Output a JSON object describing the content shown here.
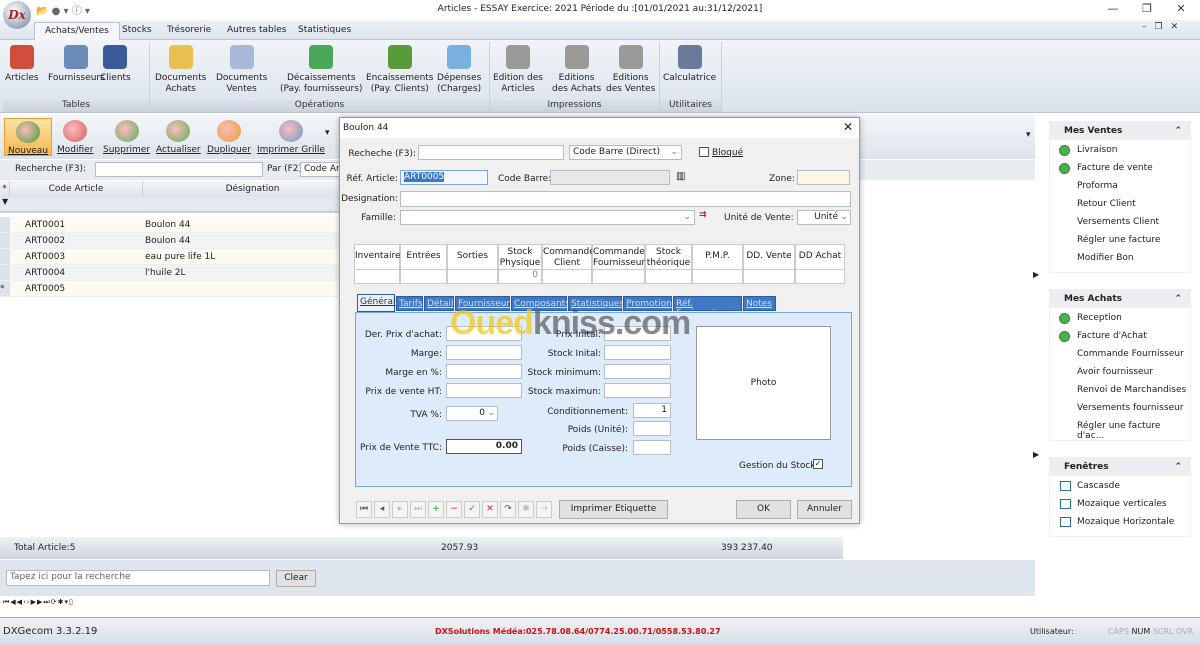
{
  "window": {
    "title": "Articles - ESSAY Exercice: 2021 Période du :[01/01/2021 au:31/12/2021]",
    "logo": "Dx"
  },
  "ribbon_tabs": [
    "Achats/Ventes",
    "Stocks",
    "Trésorerie",
    "Autres tables",
    "Statistiques"
  ],
  "ribbon_groups": [
    {
      "label": "Tables",
      "buttons": [
        "Articles",
        "Fournisseurs",
        "Clients"
      ]
    },
    {
      "label": "Opérations",
      "buttons": [
        "Documents\nAchats",
        "Documents\nVentes",
        "Décaissements\n(Pay. fournisseurs)",
        "Encaissements\n(Pay. Clients)",
        "Dépenses\n(Charges)"
      ]
    },
    {
      "label": "Impressions",
      "buttons": [
        "Edition des\nArticles",
        "Editions\ndes Achats",
        "Editions\ndes Ventes"
      ]
    },
    {
      "label": "Utilitaires",
      "buttons": [
        "Calculatrice"
      ]
    }
  ],
  "toolbar": [
    "Nouveau",
    "Modifier",
    "Supprimer",
    "Actualiser",
    "Dupliquer",
    "Imprimer Grille"
  ],
  "search": {
    "label": "Recherche (F3):",
    "value": "",
    "par_label": "Par (F2)",
    "par_value": "Code Article"
  },
  "grid": {
    "columns": [
      "Code Article",
      "Désignation"
    ],
    "rows": [
      [
        "ART0001",
        "Boulon 44"
      ],
      [
        "ART0002",
        "Boulon 44"
      ],
      [
        "ART0003",
        "eau  pure life 1L"
      ],
      [
        "ART0004",
        "l'huile 2L"
      ],
      [
        "ART0005",
        ""
      ]
    ]
  },
  "footer": {
    "total": "Total Article:5",
    "sum1": "2057.93",
    "sum2": "393 237.40",
    "search_placeholder": "Tapez ici pour la recherche",
    "clear": "Clear"
  },
  "dialog": {
    "title": "Boulon 44",
    "recherche_label": "Recheche (F3):",
    "recherche_value": "",
    "mode": "Code Barre (Direct)",
    "bloque": "Bloqué",
    "bloque_checked": false,
    "ref_label": "Réf. Article:",
    "ref_value": "ART0005",
    "codebarre_label": "Code Barre:",
    "zone_label": "Zone:",
    "designation_label": "Designation:",
    "famille_label": "Famille:",
    "unite_label": "Unité de Vente:",
    "unite_value": "Unité",
    "stock_headers": [
      "Inventaire",
      "Entrées",
      "Sorties",
      "Stock\nPhysique",
      "Commandes\nClient",
      "Commande\nFournisseur",
      "Stock\nthéorique",
      "P.M.P.",
      "DD. Vente",
      "DD Achat"
    ],
    "stock_values": [
      "",
      "",
      "",
      "0",
      "",
      "",
      "",
      "",
      "",
      ""
    ],
    "tabs": [
      "Général",
      "Tarifs",
      "Détail",
      "Fournisseurs",
      "Composants",
      "Statistiques",
      "Promotion",
      "Réf. Fusionnées",
      "Notes"
    ],
    "left_fields": [
      "Der. Prix d'achat:",
      "Marge:",
      "Marge en %:",
      "Prix de vente HT:"
    ],
    "tva_label": "TVA %:",
    "tva_value": "0",
    "ttc_label": "Prix de Vente TTC:",
    "ttc_value": "0.00",
    "mid_fields": [
      "Prix Inital:",
      "Stock Inital:",
      "Stock minimum:",
      "Stock maximun:"
    ],
    "cond_label": "Conditionnement:",
    "cond_value": "1",
    "poids_unite": "Poids (Unité):",
    "poids_caisse": "Poids (Caisse):",
    "photo": "Photo",
    "gestion_stock": "Gestion du Stock",
    "gestion_checked": true,
    "print_label": "Imprimer Etiquette",
    "ok": "OK",
    "cancel": "Annuler"
  },
  "watermark": "Ouedkniss.com",
  "right_panel": [
    {
      "title": "Mes Ventes",
      "items": [
        {
          "label": "Livraison",
          "icon": "green-arrow-right"
        },
        {
          "label": "Facture de vente",
          "icon": "green-arrow-right"
        },
        {
          "label": "Proforma"
        },
        {
          "label": "Retour Client"
        },
        {
          "label": "Versements Client"
        },
        {
          "label": "Régler une facture"
        },
        {
          "label": "Modifier Bon"
        }
      ]
    },
    {
      "title": "Mes Achats",
      "items": [
        {
          "label": "Reception",
          "icon": "green-arrow-left"
        },
        {
          "label": "Facture d'Achat",
          "icon": "green-arrow-left"
        },
        {
          "label": "Commande Fournisseur"
        },
        {
          "label": "Avoir fournisseur"
        },
        {
          "label": "Renvoi de Marchandises"
        },
        {
          "label": "Versements fournisseur"
        },
        {
          "label": "Régler une facture d'ac..."
        }
      ]
    },
    {
      "title": "Fenêtres",
      "items": [
        {
          "label": "Cascasde",
          "icon": "cascade"
        },
        {
          "label": "Mozaique verticales",
          "icon": "tile-vertical"
        },
        {
          "label": "Mozaique Horizontale",
          "icon": "tile-horizontal"
        }
      ]
    }
  ],
  "status": {
    "version": "DXGecom 3.3.2.19",
    "contact": "DXSolutions Médéa:025.78.08.64/0774.25.00.71/0558.53.80.27",
    "user_label": "Utilisateur:",
    "keys": [
      "CAPS",
      "NUM",
      "SCRL",
      "OVR"
    ]
  },
  "colors": {
    "accent": "#3f78c4",
    "contact": "#d01010",
    "active_tool": "#f8b64a"
  }
}
